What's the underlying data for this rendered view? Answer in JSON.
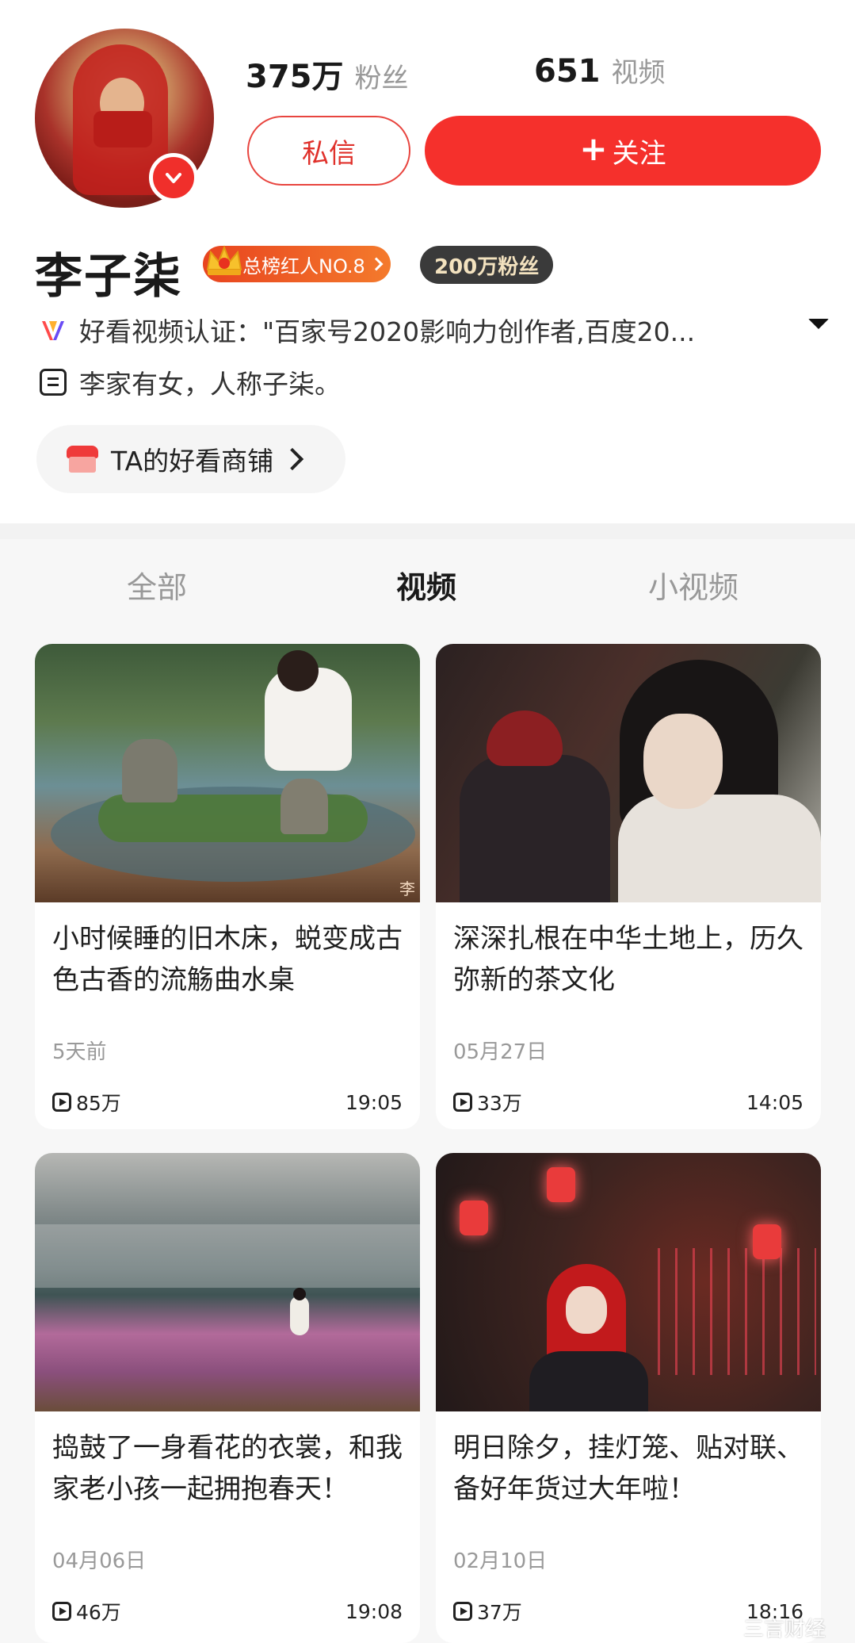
{
  "profile": {
    "fans_count": "375万",
    "fans_label": "粉丝",
    "videos_count": "651",
    "videos_label": "视频",
    "message_button": "私信",
    "follow_plus": "+",
    "follow_button": "关注",
    "name": "李子柒",
    "rank_badge": "总榜红人NO.8",
    "fans_badge": "200万粉丝",
    "certification": "好看视频认证：\"百家号2020影响力创作者,百度20...",
    "bio": "李家有女，人称子柒。",
    "shop_label": "TA的好看商铺"
  },
  "tabs": [
    {
      "label": "全部",
      "active": false
    },
    {
      "label": "视频",
      "active": true
    },
    {
      "label": "小视频",
      "active": false
    }
  ],
  "videos": [
    {
      "title": "小时候睡的旧木床，蜕变成古色古香的流觞曲水桌",
      "date": "5天前",
      "plays": "85万",
      "duration": "19:05",
      "thumb_mark": "李"
    },
    {
      "title": "深深扎根在中华土地上，历久弥新的茶文化",
      "date": "05月27日",
      "plays": "33万",
      "duration": "14:05"
    },
    {
      "title": "捣鼓了一身看花的衣裳，和我家老小孩一起拥抱春天！",
      "date": "04月06日",
      "plays": "46万",
      "duration": "19:08"
    },
    {
      "title": "明日除夕，挂灯笼、贴对联、备好年货过大年啦！",
      "date": "02月10日",
      "plays": "37万",
      "duration": "18:16"
    }
  ],
  "watermark": "三言财经",
  "colors": {
    "accent": "#f5302c",
    "muted": "#999999",
    "badge_dark": "#3a3a3a"
  },
  "icons": [
    "verified-v-icon",
    "crown-icon",
    "haokan-v-icon",
    "expand-arrow-icon",
    "doc-icon",
    "shop-icon",
    "chevron-right-icon",
    "play-icon"
  ]
}
